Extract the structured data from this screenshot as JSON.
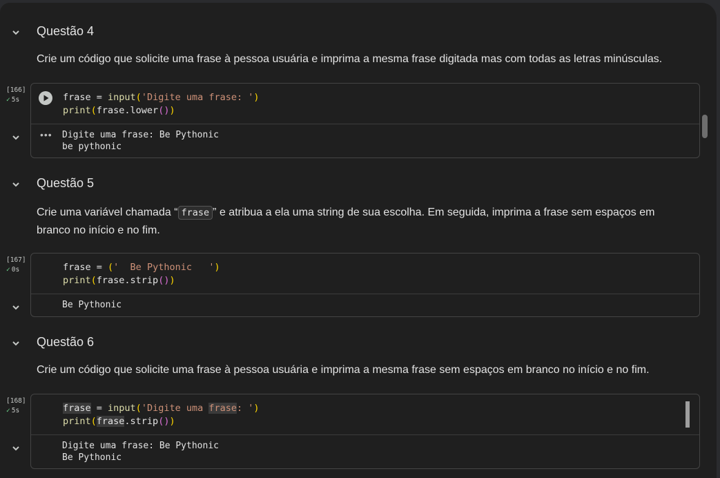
{
  "sections": [
    {
      "title": "Questão 4",
      "description": "Crie um código que solicite uma frase à pessoa usuária e imprima a mesma frase digitada mas com todas as letras minúsculas.",
      "cell": {
        "exec_count": "[166]",
        "exec_time": "5s",
        "code": [
          "frase = input('Digite uma frase: ')",
          "print(frase.lower())"
        ],
        "output": [
          "Digite uma frase: Be Pythonic",
          "be pythonic"
        ]
      }
    },
    {
      "title": "Questão 5",
      "description_pre": "Crie uma variável chamada “",
      "description_code": "frase",
      "description_post": "” e atribua a ela uma string de sua escolha. Em seguida, imprima a frase sem espaços em branco no início e no fim.",
      "cell": {
        "exec_count": "[167]",
        "exec_time": "0s",
        "code": [
          "frase = ('  Be Pythonic   ')",
          "print(frase.strip())"
        ],
        "output": [
          "Be Pythonic"
        ]
      }
    },
    {
      "title": "Questão 6",
      "description": "Crie um código que solicite uma frase à pessoa usuária e imprima a mesma frase sem espaços em branco no início e no fim.",
      "cell": {
        "exec_count": "[168]",
        "exec_time": "5s",
        "code": [
          "frase = input('Digite uma frase: ')",
          "print(frase.strip())"
        ],
        "output": [
          "Digite uma frase: Be Pythonic",
          "Be Pythonic"
        ]
      }
    }
  ],
  "colors": {
    "background": "#1f1f1f",
    "check": "#6dd58c",
    "string": "#ce9178",
    "function": "#dcdcaa",
    "paren": "#ffd700"
  },
  "icons": {
    "collapse": "chevron-down-icon",
    "run": "play-circle-icon",
    "output_menu": "more-horiz-icon",
    "status": "check-icon"
  }
}
